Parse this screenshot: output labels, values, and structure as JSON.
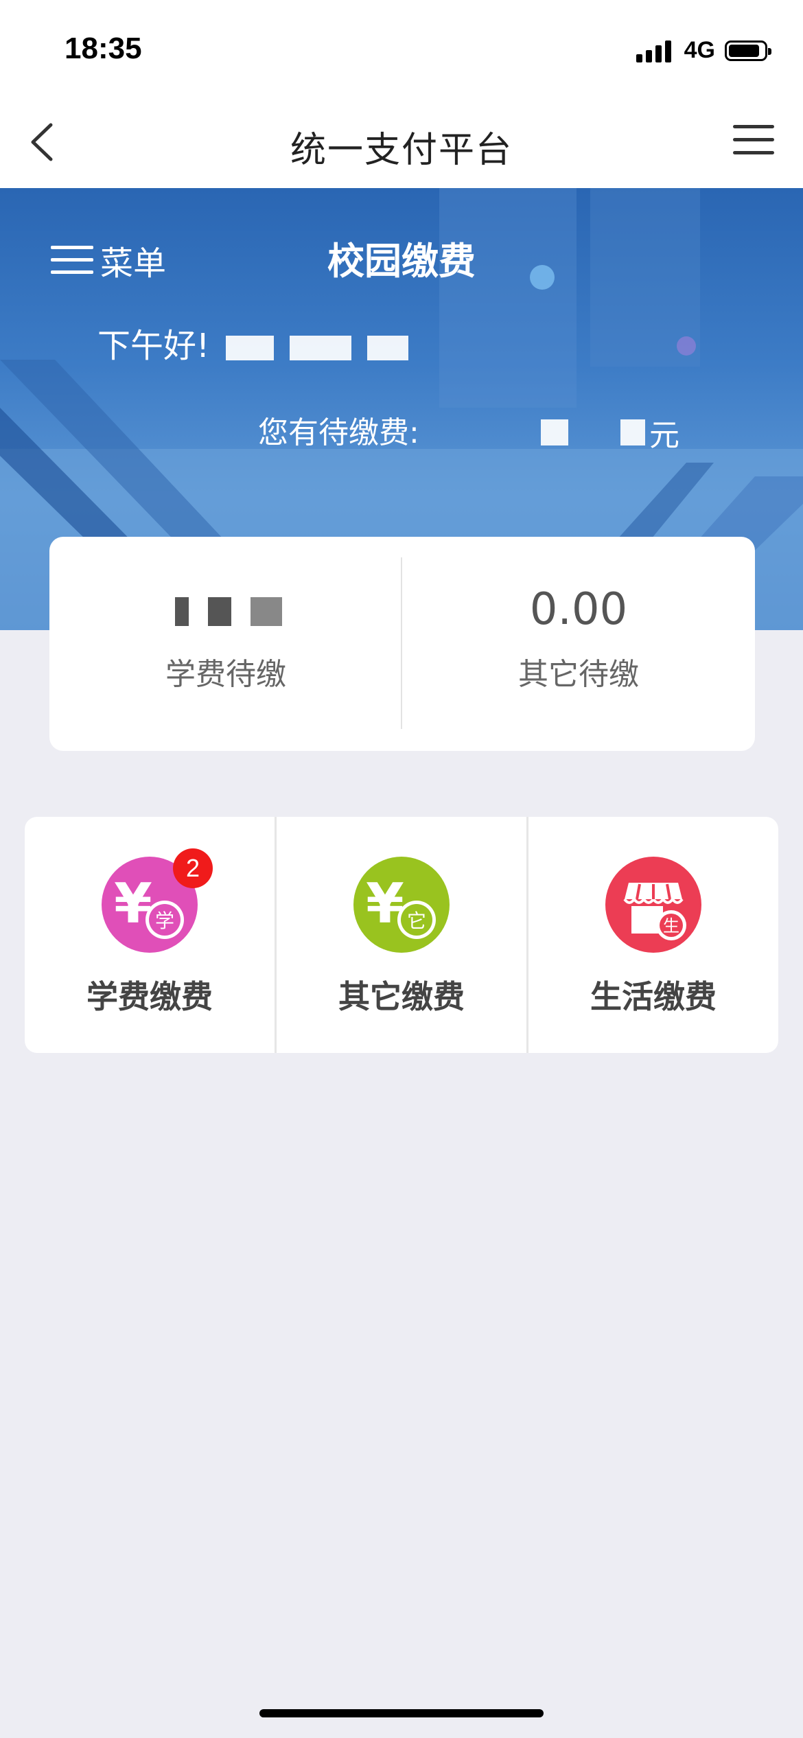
{
  "status_bar": {
    "time": "18:35",
    "network": "4G",
    "icons": [
      "signal-icon",
      "battery-icon"
    ]
  },
  "nav": {
    "title": "统一支付平台",
    "icons": [
      "back-arrow-icon",
      "more-menu-icon"
    ]
  },
  "banner": {
    "menu_label": "菜单",
    "title": "校园缴费",
    "greeting": "下午好!",
    "pending_label": "您有待缴费:",
    "pending_unit": "元",
    "colors": {
      "primary": "#2a66b3"
    }
  },
  "summary": {
    "other_value": "0.00",
    "tuition_label": "学费待缴",
    "other_label": "其它待缴"
  },
  "services": [
    {
      "label": "学费缴费",
      "icon": "tuition-yuan-icon",
      "icon_char": "学",
      "color": "#e04fb8",
      "badge": "2"
    },
    {
      "label": "其它缴费",
      "icon": "other-yuan-icon",
      "icon_char": "它",
      "color": "#99c31f"
    },
    {
      "label": "生活缴费",
      "icon": "life-store-icon",
      "icon_char": "生",
      "color": "#ec3d54"
    }
  ]
}
